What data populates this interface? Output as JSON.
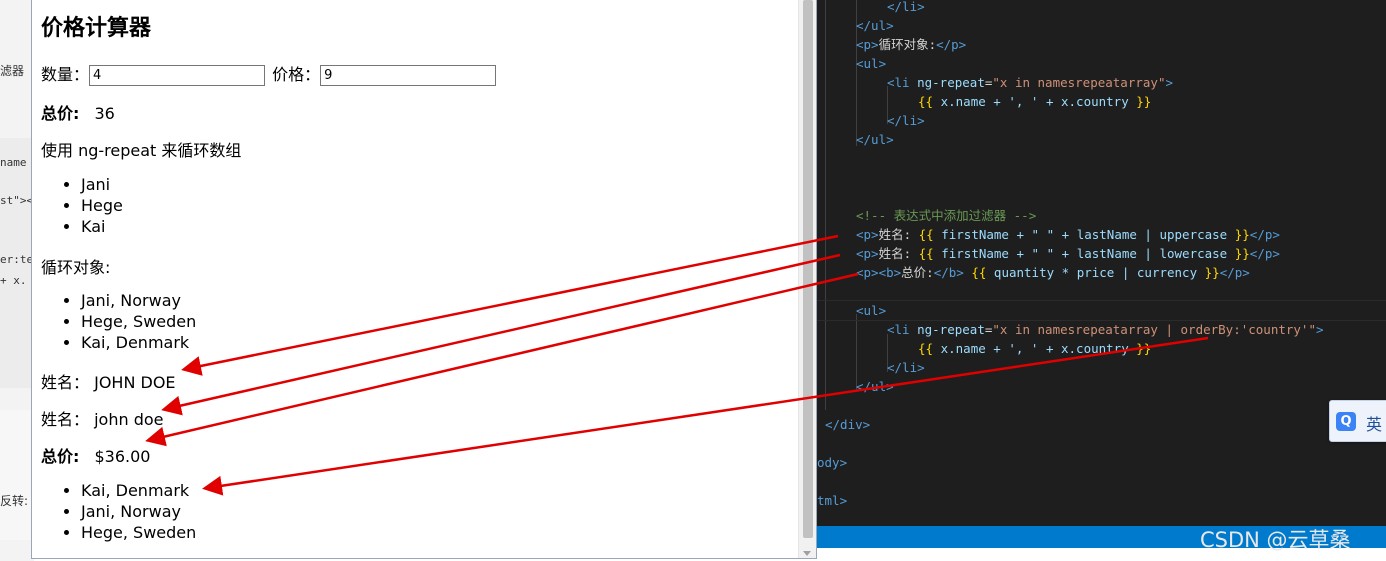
{
  "background_window": {
    "fragments": [
      "滤器",
      "name",
      "st\"><",
      "er:te",
      "+ x.",
      "反转:"
    ]
  },
  "page": {
    "title": "价格计算器",
    "quantity_label": "数量：",
    "quantity_value": "4",
    "price_label": "价格：",
    "price_value": "9",
    "total_label": "总价:",
    "total_value": "36",
    "repeat_intro": "使用 ng-repeat 来循环数组",
    "names": [
      "Jani",
      "Hege",
      "Kai"
    ],
    "loop_objects_label": "循环对象:",
    "people": [
      "Jani, Norway",
      "Hege, Sweden",
      "Kai, Denmark"
    ],
    "upper_label": "姓名：",
    "upper_value": "JOHN DOE",
    "lower_label": "姓名：",
    "lower_value": "john doe",
    "currency_label": "总价:",
    "currency_value": "$36.00",
    "ordered_people": [
      "Kai, Denmark",
      "Jani, Norway",
      "Hege, Sweden"
    ]
  },
  "editor": {
    "lines": {
      "l1_close_li": "</li>",
      "l2_close_ul": "</ul>",
      "l3_p_open": "<p>",
      "l3_text": "循环对象:",
      "l3_p_close": "</p>",
      "l4_ul": "<ul>",
      "l5_li_open": "<li",
      "l5_attr": "ng-repeat",
      "l5_str": "\"x in namesrepeatarray\"",
      "l6_expr_open": "{{",
      "l6_expr": " x.name + ', ' + x.country ",
      "l6_expr_close": "}}",
      "l7_close_li": "</li>",
      "l8_close_ul": "</ul>",
      "comment": "<!-- 表达式中添加过滤器 -->",
      "f1_text": "姓名:",
      "f1_expr": " firstName + \" \" + lastName | uppercase ",
      "f2_text": "姓名:",
      "f2_expr": " firstName + \" \" + lastName | lowercase ",
      "f3_b_text": "总价:",
      "f3_expr": " quantity * price | currency ",
      "o_ul": "<ul>",
      "o_li_open": "<li",
      "o_attr": "ng-repeat",
      "o_str": "\"x in namesrepeatarray | orderBy:'country'\"",
      "o_expr": " x.name + ', ' + x.country ",
      "o_close_li": "</li>",
      "o_close_ul": "</ul>",
      "close_div": "</div>",
      "close_body": "ody>",
      "close_html": "tml>"
    }
  },
  "watermark": "CSDN @云草桑",
  "ime_label": "英",
  "ime_logo": "Q",
  "colors": {
    "arrow": "#e00000",
    "editor_bg": "#1e1e1e",
    "statusbar": "#007acc"
  }
}
